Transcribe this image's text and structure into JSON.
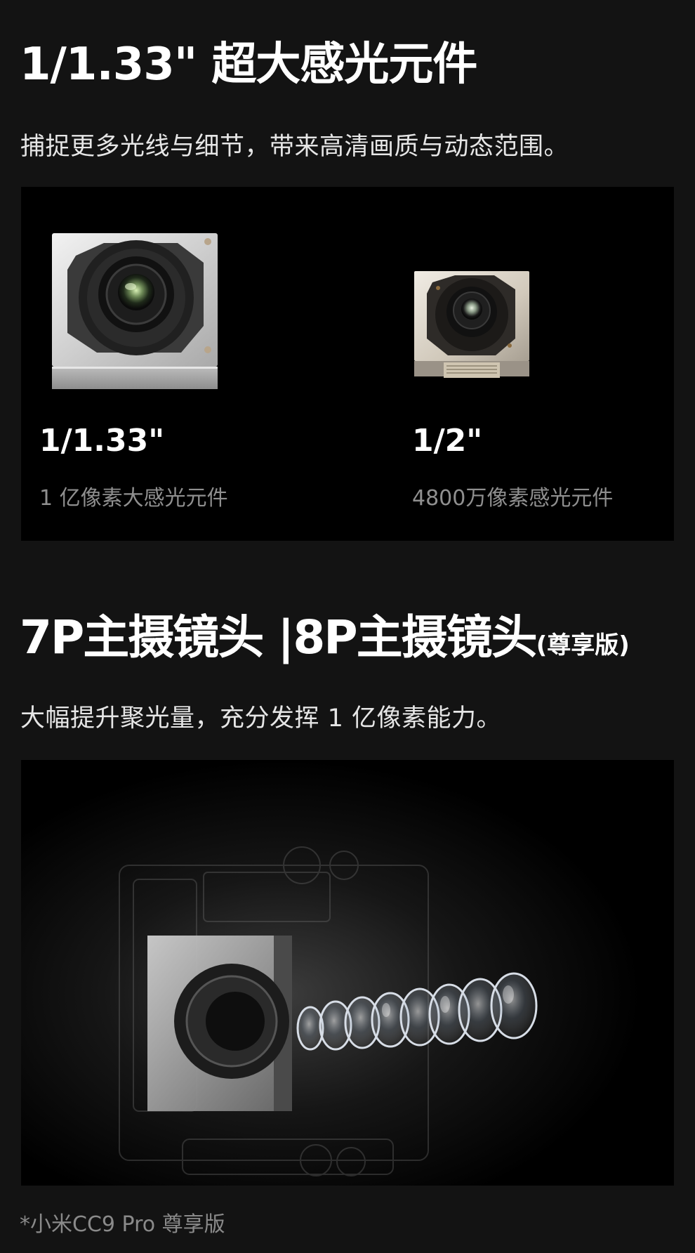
{
  "section1": {
    "title": "1/1.33\" 超大感光元件",
    "subtitle": "捕捉更多光线与细节，带来高清画质与动态范围。",
    "sensors": [
      {
        "size": "1/1.33\"",
        "desc": "1 亿像素大感光元件"
      },
      {
        "size": "1/2\"",
        "desc": "4800万像素感光元件"
      }
    ]
  },
  "section2": {
    "title_main": "7P主摄镜头 |8P主摄镜头",
    "title_note": "(尊享版)",
    "subtitle": "大幅提升聚光量，充分发挥 1 亿像素能力。"
  },
  "footnote": "*小米CC9 Pro 尊享版",
  "colors": {
    "page_bg": "#131313",
    "panel_bg": "#000000",
    "title": "#ffffff",
    "muted": "#8f8f8f"
  }
}
